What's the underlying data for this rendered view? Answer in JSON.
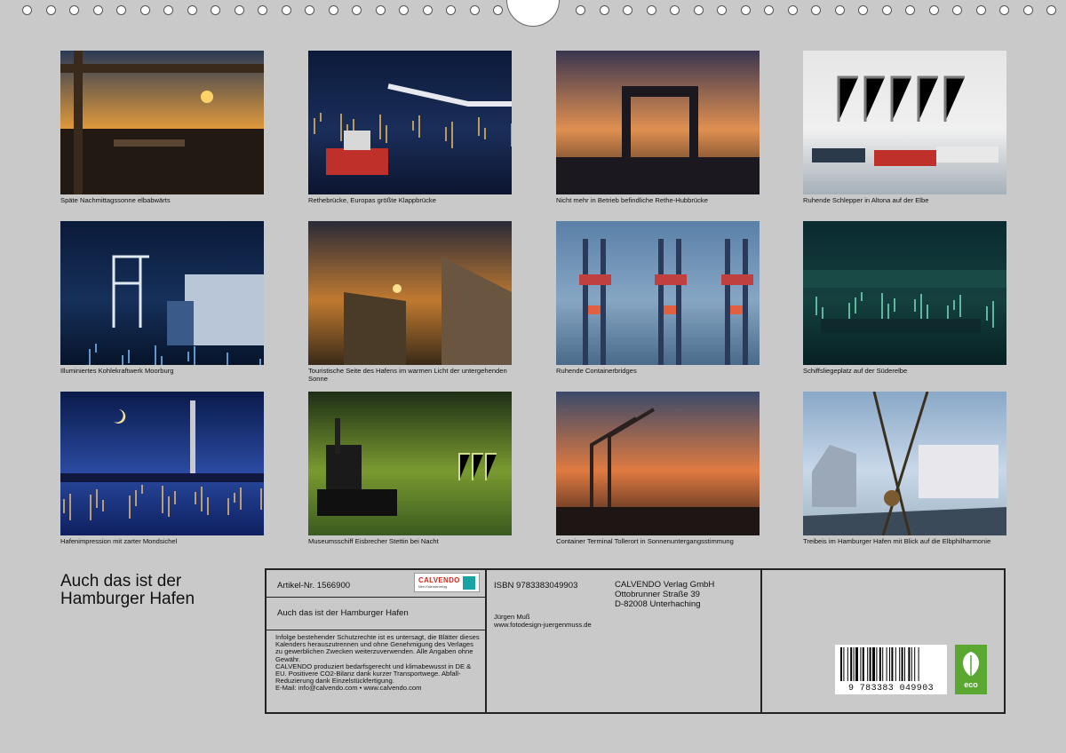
{
  "photos": [
    {
      "caption": "Späte Nachmittagssonne elbabwärts",
      "theme": "sunset-terrace"
    },
    {
      "caption": "Rethebrücke, Europas größte Klappbrücke",
      "theme": "night-bridge"
    },
    {
      "caption": "Nicht mehr in Betrieb befindliche Rethe-Hubbrücke",
      "theme": "lift-bridge"
    },
    {
      "caption": "Ruhende Schlepper in Altona auf der Elbe",
      "theme": "tugboats"
    },
    {
      "caption": "Illuminiertes Kohlekraftwerk Moorburg",
      "theme": "power-plant"
    },
    {
      "caption": "Touristische Seite des Hafens im warmen Licht der untergehenden Sonne",
      "theme": "pier-sunset"
    },
    {
      "caption": "Ruhende Containerbridges",
      "theme": "cranes-blue"
    },
    {
      "caption": "Schiffsliegeplatz auf der Süderelbe",
      "theme": "berth-night"
    },
    {
      "caption": "Hafenimpression mit zarter Mondsichel",
      "theme": "moon-harbor"
    },
    {
      "caption": "Museumsschiff Eisbrecher Stettin bei Nacht",
      "theme": "green-night"
    },
    {
      "caption": "Container Terminal Tollerort in Sonnenuntergangsstimmung",
      "theme": "terminal-sunset"
    },
    {
      "caption": "Treibeis im Hamburger Hafen mit Blick auf die Elbphilharmonie",
      "theme": "elbphilharmonie"
    }
  ],
  "title_line1": "Auch das ist der",
  "title_line2": "Hamburger Hafen",
  "info": {
    "article": "Artikel-Nr. 1566900",
    "logo_text": "CALVENDO",
    "logo_sub": "Mein Kalenderverlag",
    "calendar_title": "Auch das ist der Hamburger Hafen",
    "legal": "Infolge bestehender Schutzrechte ist es untersagt, die Blätter dieses Kalenders herauszutrennen und ohne Genehmigung des Verlages zu gewerblichen Zwecken weiterzuverwenden. Alle Angaben ohne Gewähr.\nCALVENDO produziert bedarfsgerecht und klimabewusst in DE & EU. Positivere CO2-Bilanz dank kurzer Transportwege. Abfall-Reduzierung dank Einzelstückfertigung.\nE-Mail: info@calvendo.com • www.calvendo.com",
    "isbn": "ISBN 9783383049903",
    "publisher_name": "CALVENDO Verlag GmbH",
    "publisher_street": "Ottobrunner Straße 39",
    "publisher_city": "D-82008 Unterhaching",
    "author": "Jürgen Muß",
    "author_web": "www.fotodesign-juergenmuss.de",
    "barcode_digits": "9 783383 049903",
    "eco_label": "eco"
  },
  "colors": {
    "page_bg": "#c9c9c9",
    "calvendo_red": "#d9261c",
    "eco_green": "#5aa832"
  }
}
